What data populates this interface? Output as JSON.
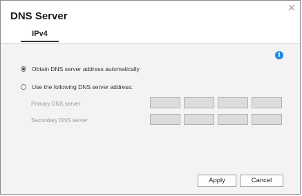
{
  "dialog": {
    "title": "DNS Server",
    "tabs": [
      {
        "label": "IPv4"
      }
    ]
  },
  "options": {
    "auto": {
      "label": "Obtain DNS server address automatically",
      "selected": true
    },
    "manual": {
      "label": "Use the following DNS server address:",
      "selected": false
    }
  },
  "fields": {
    "primary": {
      "label": "Primary DNS server",
      "octets": [
        "",
        "",
        "",
        ""
      ],
      "separator": "."
    },
    "secondary": {
      "label": "Secondary DNS server",
      "octets": [
        "",
        "",
        "",
        ""
      ],
      "separator": "."
    }
  },
  "buttons": {
    "apply": "Apply",
    "cancel": "Cancel"
  },
  "icons": {
    "info": "info-icon",
    "close": "close-icon"
  },
  "colors": {
    "info": "#1e88e5",
    "field_disabled": "#dcdcdc",
    "panel_bg": "#f3f3f3"
  }
}
